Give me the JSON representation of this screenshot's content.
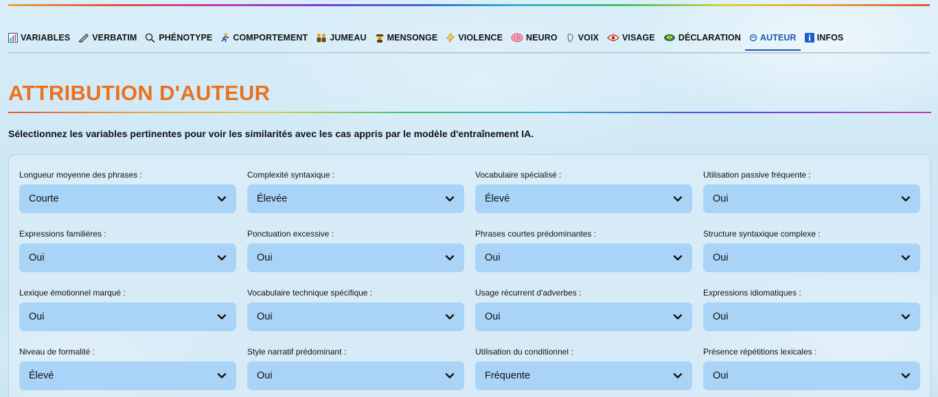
{
  "nav": {
    "items": [
      {
        "label": "VARIABLES",
        "icon": "bar-chart-icon"
      },
      {
        "label": "VERBATIM",
        "icon": "pen-icon"
      },
      {
        "label": "PHÉNOTYPE",
        "icon": "magnifier-icon"
      },
      {
        "label": "COMPORTEMENT",
        "icon": "running-person-icon"
      },
      {
        "label": "JUMEAU",
        "icon": "twins-icon"
      },
      {
        "label": "MENSONGE",
        "icon": "detective-icon"
      },
      {
        "label": "VIOLENCE",
        "icon": "lightning-icon"
      },
      {
        "label": "NEURO",
        "icon": "brain-icon"
      },
      {
        "label": "VOIX",
        "icon": "voice-icon"
      },
      {
        "label": "VISAGE",
        "icon": "eye-icon"
      },
      {
        "label": "DÉCLARATION",
        "icon": "disc-icon"
      },
      {
        "label": "AUTEUR",
        "icon": "author-icon"
      },
      {
        "label": "INFOS",
        "icon": "info-icon"
      }
    ],
    "active": "AUTEUR"
  },
  "page": {
    "title": "ATTRIBUTION D'AUTEUR",
    "description": "Sélectionnez les variables pertinentes pour voir les similarités avec les cas appris par le modèle d'entraînement IA."
  },
  "fields": [
    {
      "label": "Longueur moyenne des phrases :",
      "value": "Courte"
    },
    {
      "label": "Complexité syntaxique :",
      "value": "Élevée"
    },
    {
      "label": "Vocabulaire spécialisé :",
      "value": "Élevé"
    },
    {
      "label": "Utilisation passive fréquente :",
      "value": "Oui"
    },
    {
      "label": "Expressions familières :",
      "value": "Oui"
    },
    {
      "label": "Ponctuation excessive :",
      "value": "Oui"
    },
    {
      "label": "Phrases courtes prédominantes :",
      "value": "Oui"
    },
    {
      "label": "Structure syntaxique complexe :",
      "value": "Oui"
    },
    {
      "label": "Lexique émotionnel marqué :",
      "value": "Oui"
    },
    {
      "label": "Vocabulaire technique spécifique :",
      "value": "Oui"
    },
    {
      "label": "Usage récurrent d'adverbes :",
      "value": "Oui"
    },
    {
      "label": "Expressions idiomatiques :",
      "value": "Oui"
    },
    {
      "label": "Niveau de formalité :",
      "value": "Élevé"
    },
    {
      "label": "Style narratif prédominant :",
      "value": "Oui"
    },
    {
      "label": "Utilisation du conditionnel :",
      "value": "Fréquente"
    },
    {
      "label": "Présence répétitions lexicales :",
      "value": "Oui"
    }
  ],
  "colors": {
    "title": "#e8721f",
    "select_bg": "#a9d4f8",
    "active_tab": "#1a5aa8"
  }
}
